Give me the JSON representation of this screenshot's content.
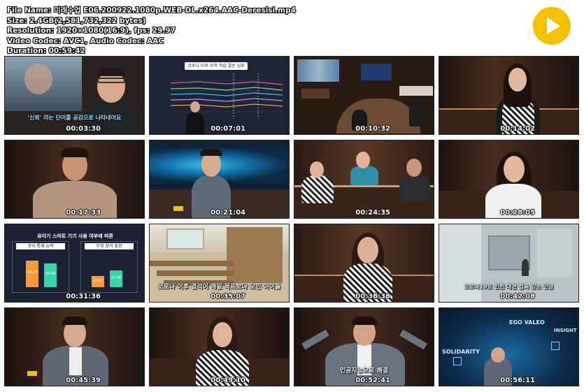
{
  "info": {
    "line1": "File Name: 미래수업 E06.200922.1080p.WEB-DL.x264.AAC-Deresisi.mp4",
    "line2": "Size: 2.4GB(2,581,732,322 bytes)",
    "line3": "Resolution: 1920×1080(16:9), fps: 29.97",
    "line4": "Video Codec: AVC1, Audio Codec: AAC",
    "line5": "Duration: 00:59:42"
  },
  "logo_text": "미래수업",
  "thumbnails": [
    {
      "time": "00:03:30",
      "subtitle": "'신뢰' 라는 단어를 공감으로 나타내어요"
    },
    {
      "time": "00:07:01",
      "subtitle": "코로나 이후 수학 학습 결손 심화"
    },
    {
      "time": "00:10:32",
      "subtitle": ""
    },
    {
      "time": "00:14:02",
      "subtitle": ""
    },
    {
      "time": "00:17:33",
      "subtitle": ""
    },
    {
      "time": "00:21:04",
      "subtitle": ""
    },
    {
      "time": "00:24:35",
      "subtitle": ""
    },
    {
      "time": "00:28:05",
      "subtitle": ""
    },
    {
      "time": "00:31:36",
      "subtitle": "유아기 스마트 기기 사용 여부에 따른",
      "labels": [
        "정서 통제 능력",
        "부정 정서 표현"
      ],
      "values": [
        "58.27",
        "50.49",
        "24.67",
        "17.30"
      ]
    },
    {
      "time": "00:35:07",
      "subtitle": "코로나 이후 결석이 매일 목표보다 모인 아이들"
    },
    {
      "time": "00:38:38",
      "subtitle": ""
    },
    {
      "time": "00:42:08",
      "subtitle": "코로나19로 인한 대면 접촉 감소 만남"
    },
    {
      "time": "00:45:39",
      "subtitle": ""
    },
    {
      "time": "00:49:10",
      "subtitle": ""
    },
    {
      "time": "00:52:41",
      "subtitle": "인공지능으로 해결"
    },
    {
      "time": "00:56:11",
      "subtitle": "",
      "words": [
        "EGO VALEO",
        "INSIGHT",
        "SOLIDARITY"
      ]
    }
  ],
  "colors": {
    "logo_yellow": "#f2c200",
    "studio_brown": "#4a2c1e",
    "studio_dark": "#1c1210"
  }
}
